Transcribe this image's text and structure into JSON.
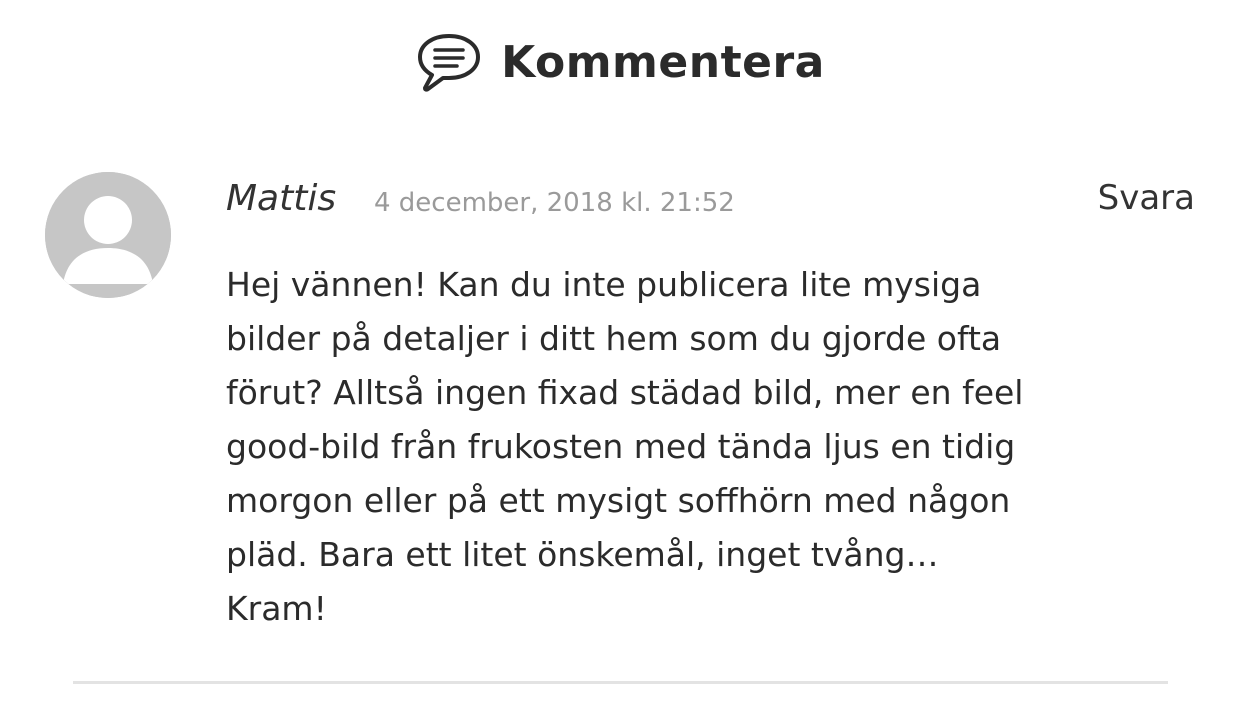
{
  "header": {
    "title": "Kommentera",
    "icon": "speech-bubble-icon"
  },
  "comment": {
    "author": "Mattis",
    "date": "4 december, 2018 kl. 21:52",
    "reply_label": "Svara",
    "body": "Hej vännen! Kan du inte publicera lite mysiga\nbilder på detaljer i ditt hem som du gjorde ofta\nförut? Alltså ingen fixad städad bild, mer en feel\ngood-bild från frukosten med tända ljus en tidig\nmorgon eller på ett mysigt soffhörn med någon\npläd. Bara ett litet önskemål, inget tvång…\nKram!",
    "avatar_icon": "user-avatar-icon"
  },
  "colors": {
    "text": "#2b2b2b",
    "muted": "#9a9a9a",
    "avatar_bg": "#c6c6c6",
    "divider": "#e3e3e3"
  }
}
